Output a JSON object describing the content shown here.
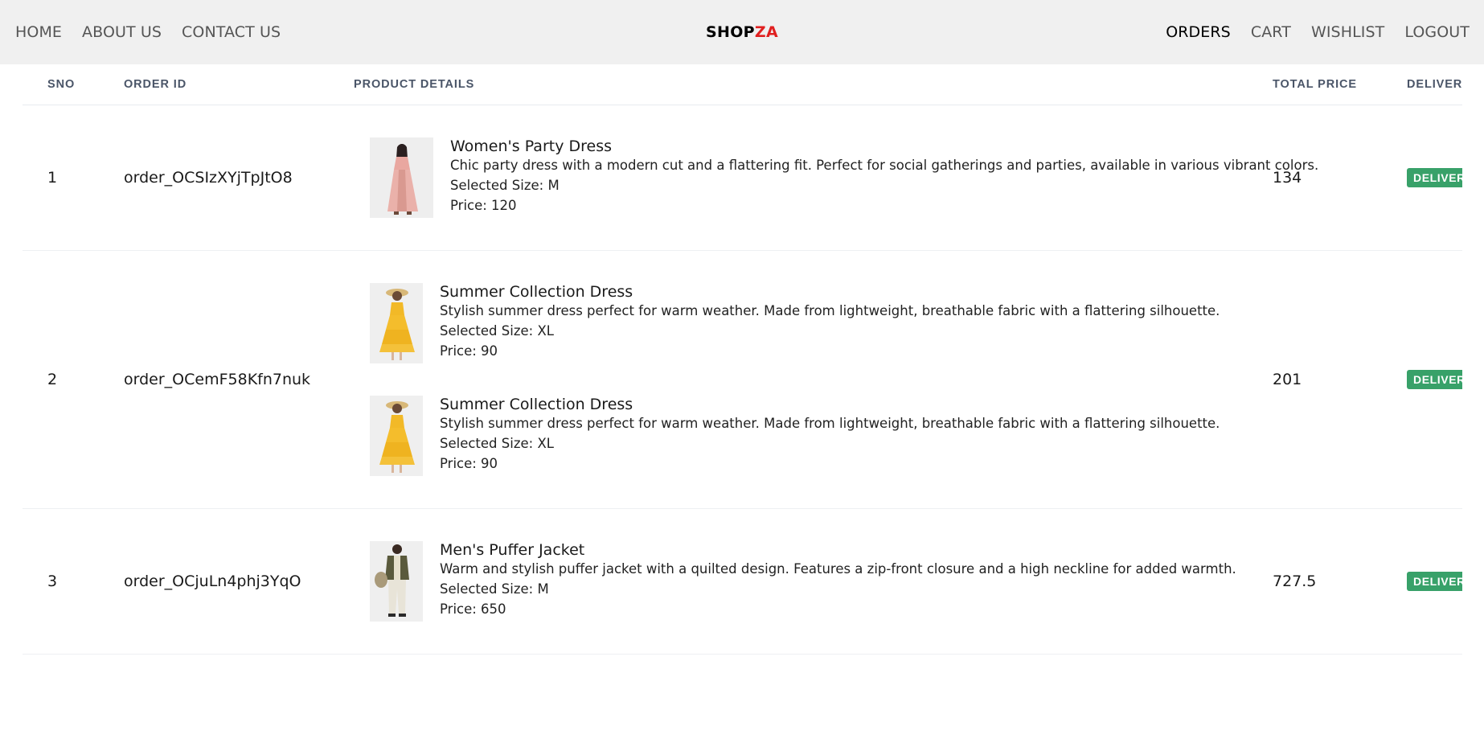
{
  "nav": {
    "left": [
      "HOME",
      "ABOUT US",
      "CONTACT US"
    ],
    "brand_primary": "SHOP",
    "brand_accent": "ZA",
    "right": [
      "ORDERS",
      "CART",
      "WISHLIST",
      "LOGOUT"
    ],
    "active": "ORDERS"
  },
  "table": {
    "headers": {
      "sno": "SNO",
      "order_id": "ORDER ID",
      "product_details": "PRODUCT DETAILS",
      "total_price": "TOTAL PRICE",
      "delivery": "DELIVER"
    },
    "rows": [
      {
        "sno": "1",
        "order_id": "order_OCSIzXYjTpJtO8",
        "total": "134",
        "status": "DELIVER",
        "products": [
          {
            "name": "Women's Party Dress",
            "description": "Chic party dress with a modern cut and a flattering fit. Perfect for social gatherings and parties, available in various vibrant colors.",
            "size": "Selected Size: M",
            "price": "Price: 120",
            "image_icon": "pink-dress-photo"
          }
        ]
      },
      {
        "sno": "2",
        "order_id": "order_OCemF58Kfn7nuk",
        "total": "201",
        "status": "DELIVER",
        "products": [
          {
            "name": "Summer Collection Dress",
            "description": "Stylish summer dress perfect for warm weather. Made from lightweight, breathable fabric with a flattering silhouette.",
            "size": "Selected Size: XL",
            "price": "Price: 90",
            "image_icon": "yellow-dress-photo"
          },
          {
            "name": "Summer Collection Dress",
            "description": "Stylish summer dress perfect for warm weather. Made from lightweight, breathable fabric with a flattering silhouette.",
            "size": "Selected Size: XL",
            "price": "Price: 90",
            "image_icon": "yellow-dress-photo"
          }
        ]
      },
      {
        "sno": "3",
        "order_id": "order_OCjuLn4phj3YqO",
        "total": "727.5",
        "status": "DELIVER",
        "products": [
          {
            "name": "Men's Puffer Jacket",
            "description": "Warm and stylish puffer jacket with a quilted design. Features a zip-front closure and a high neckline for added warmth.",
            "size": "Selected Size: M",
            "price": "Price: 650",
            "image_icon": "puffer-jacket-photo"
          }
        ]
      }
    ]
  },
  "colors": {
    "navbar_bg": "#f0f0f0",
    "brand_accent": "#e02020",
    "badge_bg": "#38a169",
    "header_text": "#4a5568"
  }
}
